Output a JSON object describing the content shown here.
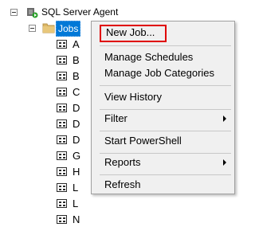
{
  "tree": {
    "agent_label": "SQL Server Agent",
    "jobs_label": "Jobs",
    "job_items": [
      "A",
      "B",
      "B",
      "C",
      "D",
      "D",
      "D",
      "G",
      "H",
      "L",
      "L",
      "N"
    ]
  },
  "context_menu": {
    "items": [
      {
        "label": "New Job..."
      },
      {
        "label": "Manage Schedules"
      },
      {
        "label": "Manage Job Categories"
      },
      {
        "label": "View History"
      },
      {
        "label": "Filter"
      },
      {
        "label": "Start PowerShell"
      },
      {
        "label": "Reports"
      },
      {
        "label": "Refresh"
      }
    ]
  },
  "colors": {
    "selection": "#0078d7",
    "highlight_border": "#e00000",
    "menu_bg": "#f0f0f0"
  }
}
